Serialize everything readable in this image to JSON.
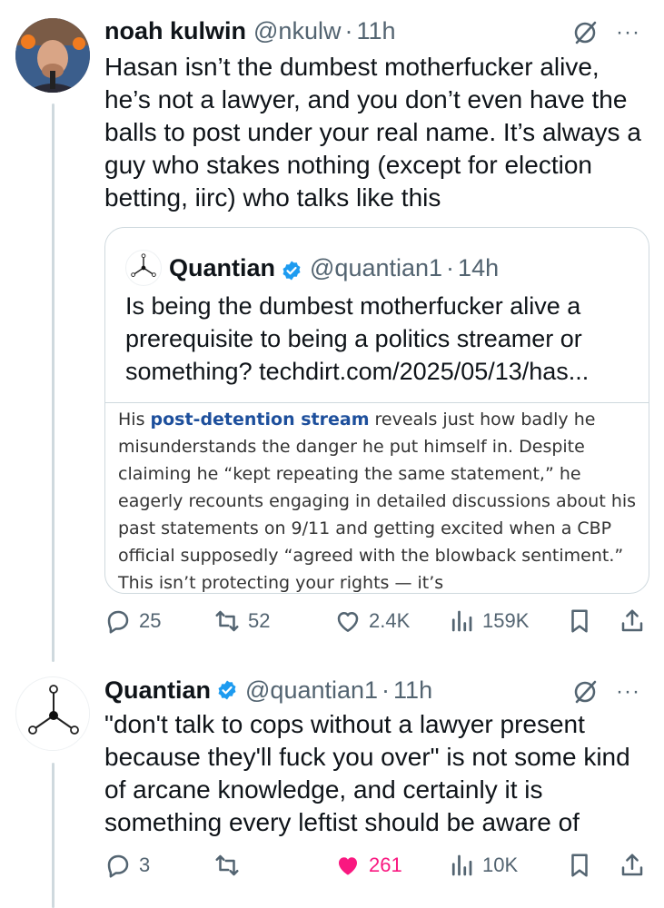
{
  "tweets": [
    {
      "name": "noah kulwin",
      "handle": "@nkulw",
      "dot": "·",
      "time": "11h",
      "text": "Hasan isn’t the dumbest motherfucker alive, he’s not a lawyer, and you don’t even have the balls to post under your real name. It’s always a guy who stakes nothing (except for election betting, iirc) who talks like this",
      "more": "···",
      "actions": {
        "replies": "25",
        "reposts": "52",
        "likes": "2.4K",
        "views": "159K"
      }
    },
    {
      "name": "Quantian",
      "handle": "@quantian1",
      "dot": "·",
      "time": "11h",
      "text": "\"don't talk to cops without a lawyer present because they'll fuck you over\" is not some kind of arcane knowledge, and certainly it is something every leftist should be aware of",
      "more": "···",
      "actions": {
        "replies": "3",
        "reposts": "",
        "likes": "261",
        "views": "10K"
      }
    }
  ],
  "quote": {
    "name": "Quantian",
    "handle": "@quantian1",
    "dot": "·",
    "time": "14h",
    "text": "Is being the dumbest motherfucker alive a prerequisite to being a politics streamer or something? techdirt.com/2025/05/13/has...",
    "article": {
      "prefix": "His ",
      "link": "post-detention stream",
      "rest": " reveals just how badly he misunderstands the danger he put himself in. Despite claiming he “kept repeating the same statement,” he eagerly recounts engaging in detailed discussions about his past statements on 9/11 and getting excited when a CBP official supposedly “agreed with the blowback sentiment.” This isn’t protecting your rights — it’s"
    }
  },
  "colors": {
    "text": "#0f1419",
    "secondary": "#536471",
    "verified": "#1d9bf0",
    "like": "#f91880",
    "thread": "#cfd9de"
  },
  "icons": [
    "grok-icon",
    "more-icon",
    "verified-icon",
    "reply-icon",
    "repost-icon",
    "like-icon",
    "views-icon",
    "bookmark-icon",
    "share-icon"
  ]
}
